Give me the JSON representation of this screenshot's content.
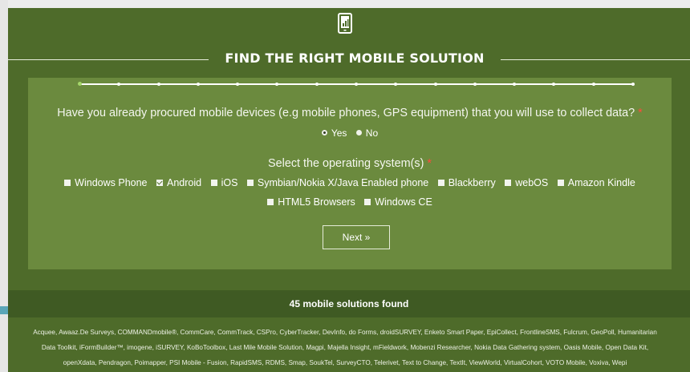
{
  "header": {
    "icon": "mobile-phone-chart-icon",
    "title": "FIND THE RIGHT MOBILE SOLUTION"
  },
  "progress": {
    "total_steps": 15,
    "current_step": 1
  },
  "question1": {
    "text": "Have you already procured mobile devices (e.g mobile phones, GPS equipment) that you will use to collect data?",
    "required_mark": "*",
    "options": [
      {
        "label": "Yes",
        "checked": true
      },
      {
        "label": "No",
        "checked": false
      }
    ]
  },
  "question2": {
    "text": "Select the operating system(s)",
    "required_mark": "*",
    "options_row1": [
      {
        "label": "Windows Phone",
        "checked": false
      },
      {
        "label": "Android",
        "checked": true
      },
      {
        "label": "iOS",
        "checked": false
      },
      {
        "label": "Symbian/Nokia X/Java Enabled phone",
        "checked": false
      },
      {
        "label": "Blackberry",
        "checked": false
      },
      {
        "label": "webOS",
        "checked": false
      },
      {
        "label": "Amazon Kindle",
        "checked": false
      }
    ],
    "options_row2": [
      {
        "label": "HTML5 Browsers",
        "checked": false
      },
      {
        "label": "Windows CE",
        "checked": false
      }
    ]
  },
  "next_label": "Next »",
  "results": {
    "count_text": "45 mobile solutions found",
    "line1": "Acquee, Awaaz.De Surveys, COMMANDmobile®, CommCare, CommTrack, CSPro, CyberTracker, DevInfo, do Forms, droidSURVEY, Enketo Smart Paper, EpiCollect, FrontlineSMS, Fulcrum, GeoPoll, Humanitarian",
    "line2": "Data Toolkit, iFormBuilder™, imogene, iSURVEY, KoBoToolbox, Last Mile Mobile Solution, Magpi, Majella Insight, mFieldwork, Mobenzi Researcher, Nokia Data Gathering system, Oasis Mobile, Open Data Kit,",
    "line3": "openXdata, Pendragon, Poimapper, PSI Mobile - Fusion, RapidSMS, RDMS, Smap, SoukTel, SurveyCTO, Telerivet, Text to Change, TextIt, ViewWorld, VirtualCohort, VOTO Mobile, Voxiva, Wepi"
  },
  "colors": {
    "panel": "#4e6b2a",
    "form_box": "#6b8a3e",
    "results_bar": "#3f5a23",
    "required": "#ff4a3d"
  }
}
